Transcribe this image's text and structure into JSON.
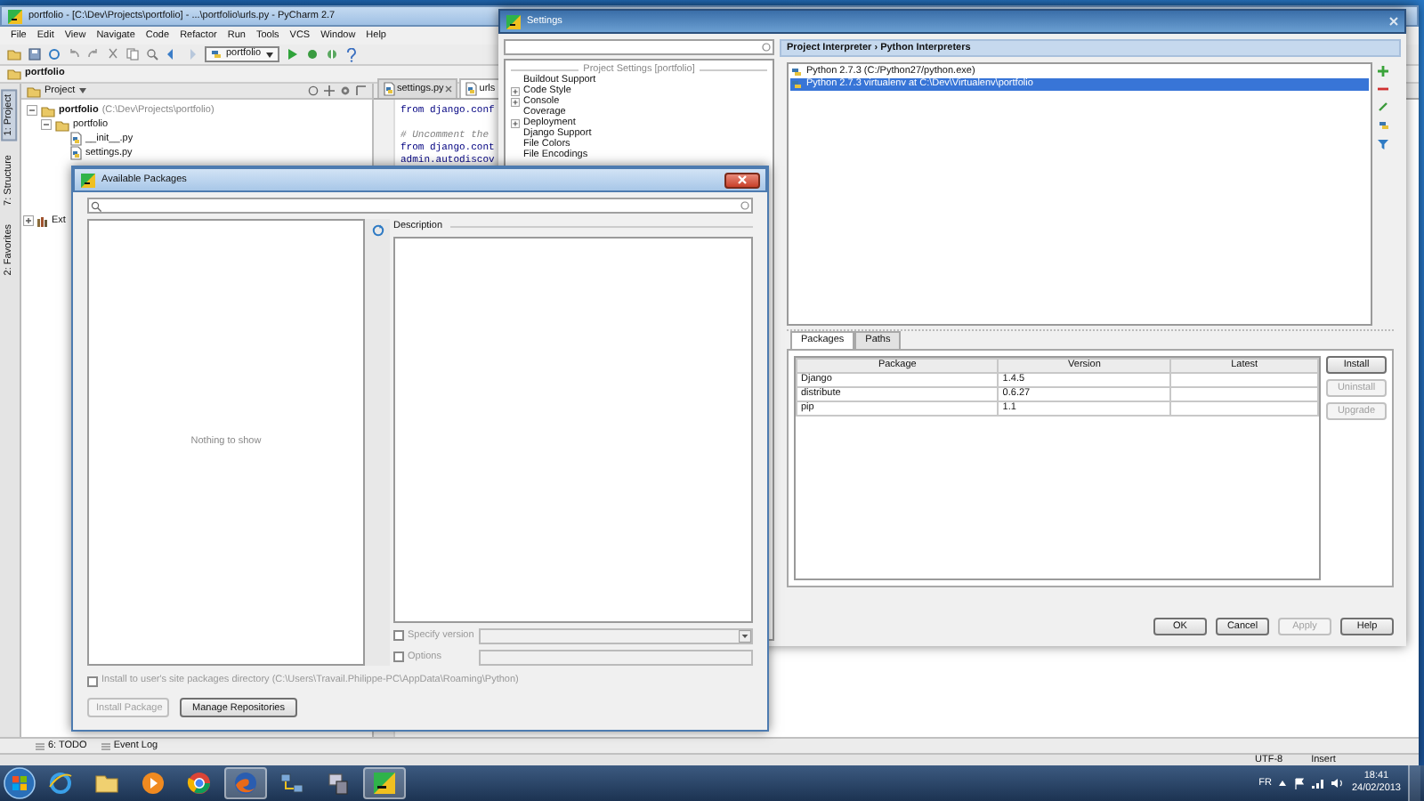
{
  "ide": {
    "title": "portfolio - [C:\\Dev\\Projects\\portfolio] - ...\\portfolio\\urls.py - PyCharm 2.7",
    "menu": [
      "File",
      "Edit",
      "View",
      "Navigate",
      "Code",
      "Refactor",
      "Run",
      "Tools",
      "VCS",
      "Window",
      "Help"
    ],
    "run_config": "portfolio",
    "breadcrumb": "portfolio",
    "tool_stripes": [
      "1: Project",
      "7: Structure",
      "2: Favorites"
    ],
    "project_view": "Project",
    "tree": [
      {
        "label": "portfolio",
        "path": "(C:\\Dev\\Projects\\portfolio)",
        "kind": "folder",
        "expanded": true,
        "children": [
          {
            "label": "portfolio",
            "kind": "folder",
            "expanded": true,
            "children": [
              {
                "label": "__init__.py",
                "kind": "file"
              },
              {
                "label": "settings.py",
                "kind": "file"
              }
            ]
          }
        ]
      },
      {
        "label": "Ext",
        "kind": "library",
        "expanded": false
      }
    ],
    "editor_tabs": [
      {
        "label": "settings.py",
        "selected": false
      },
      {
        "label": "urls",
        "selected": true
      }
    ],
    "code": [
      {
        "kind": "code",
        "text": "from django.conf"
      },
      {
        "kind": "comment",
        "text": "# Uncomment the"
      },
      {
        "kind": "code",
        "text": "from django.cont"
      },
      {
        "kind": "code",
        "text": "admin.autodiscov"
      }
    ],
    "bottom_tools": [
      "6: TODO",
      "Event Log"
    ],
    "status": [
      "UTF-8",
      "Insert"
    ]
  },
  "settings": {
    "title": "Settings",
    "tree_header": "Project Settings [portfolio]",
    "tree": [
      {
        "label": "Buildout Support",
        "kind": "leaf"
      },
      {
        "label": "Code Style",
        "kind": "group"
      },
      {
        "label": "Console",
        "kind": "group"
      },
      {
        "label": "Coverage",
        "kind": "leaf"
      },
      {
        "label": "Deployment",
        "kind": "group"
      },
      {
        "label": "Django Support",
        "kind": "leaf"
      },
      {
        "label": "File Colors",
        "kind": "leaf"
      },
      {
        "label": "File Encodings",
        "kind": "leaf"
      }
    ],
    "header": "Project Interpreter › Python Interpreters",
    "interpreters": [
      {
        "label": "Python 2.7.3 (C:/Python27/python.exe)",
        "selected": false
      },
      {
        "label": "Python 2.7.3 virtualenv at C:\\Dev\\Virtualenv\\portfolio",
        "selected": true
      }
    ],
    "tabs": [
      {
        "label": "Packages",
        "selected": true
      },
      {
        "label": "Paths",
        "selected": false
      }
    ],
    "columns": [
      "Package",
      "Version",
      "Latest"
    ],
    "rows": [
      [
        "Django",
        "1.4.5"
      ],
      [
        "distribute",
        "0.6.27"
      ],
      [
        "pip",
        "1.1"
      ]
    ],
    "side_buttons": [
      {
        "label": "Install",
        "disabled": false
      },
      {
        "label": "Uninstall",
        "disabled": true
      },
      {
        "label": "Upgrade",
        "disabled": true
      }
    ],
    "buttons": [
      {
        "label": "OK",
        "disabled": false
      },
      {
        "label": "Cancel",
        "disabled": false
      },
      {
        "label": "Apply",
        "disabled": true
      },
      {
        "label": "Help",
        "disabled": false
      }
    ]
  },
  "available": {
    "title": "Available Packages",
    "empty_text": "Nothing to show",
    "description_label": "Description",
    "options": [
      {
        "label": "Specify version",
        "checked": false,
        "kind": "select"
      },
      {
        "label": "Options",
        "checked": false,
        "kind": "text"
      }
    ],
    "user_site": {
      "label": "Install to user's site packages directory (C:\\Users\\Travail.Philippe-PC\\AppData\\Roaming\\Python)",
      "checked": false
    },
    "buttons": [
      {
        "label": "Install Package",
        "disabled": true
      },
      {
        "label": "Manage Repositories",
        "disabled": false
      }
    ]
  },
  "taskbar": {
    "apps": [
      {
        "kind": "browser-e",
        "active": false
      },
      {
        "kind": "folder",
        "active": false
      },
      {
        "kind": "media",
        "active": false
      },
      {
        "kind": "browser-ring",
        "active": false
      },
      {
        "kind": "browser-fox",
        "active": true
      },
      {
        "kind": "network",
        "active": false
      },
      {
        "kind": "devices",
        "active": false
      },
      {
        "kind": "ide",
        "active": true
      }
    ],
    "language": "FR",
    "time": "18:41",
    "date": "24/02/2013"
  }
}
